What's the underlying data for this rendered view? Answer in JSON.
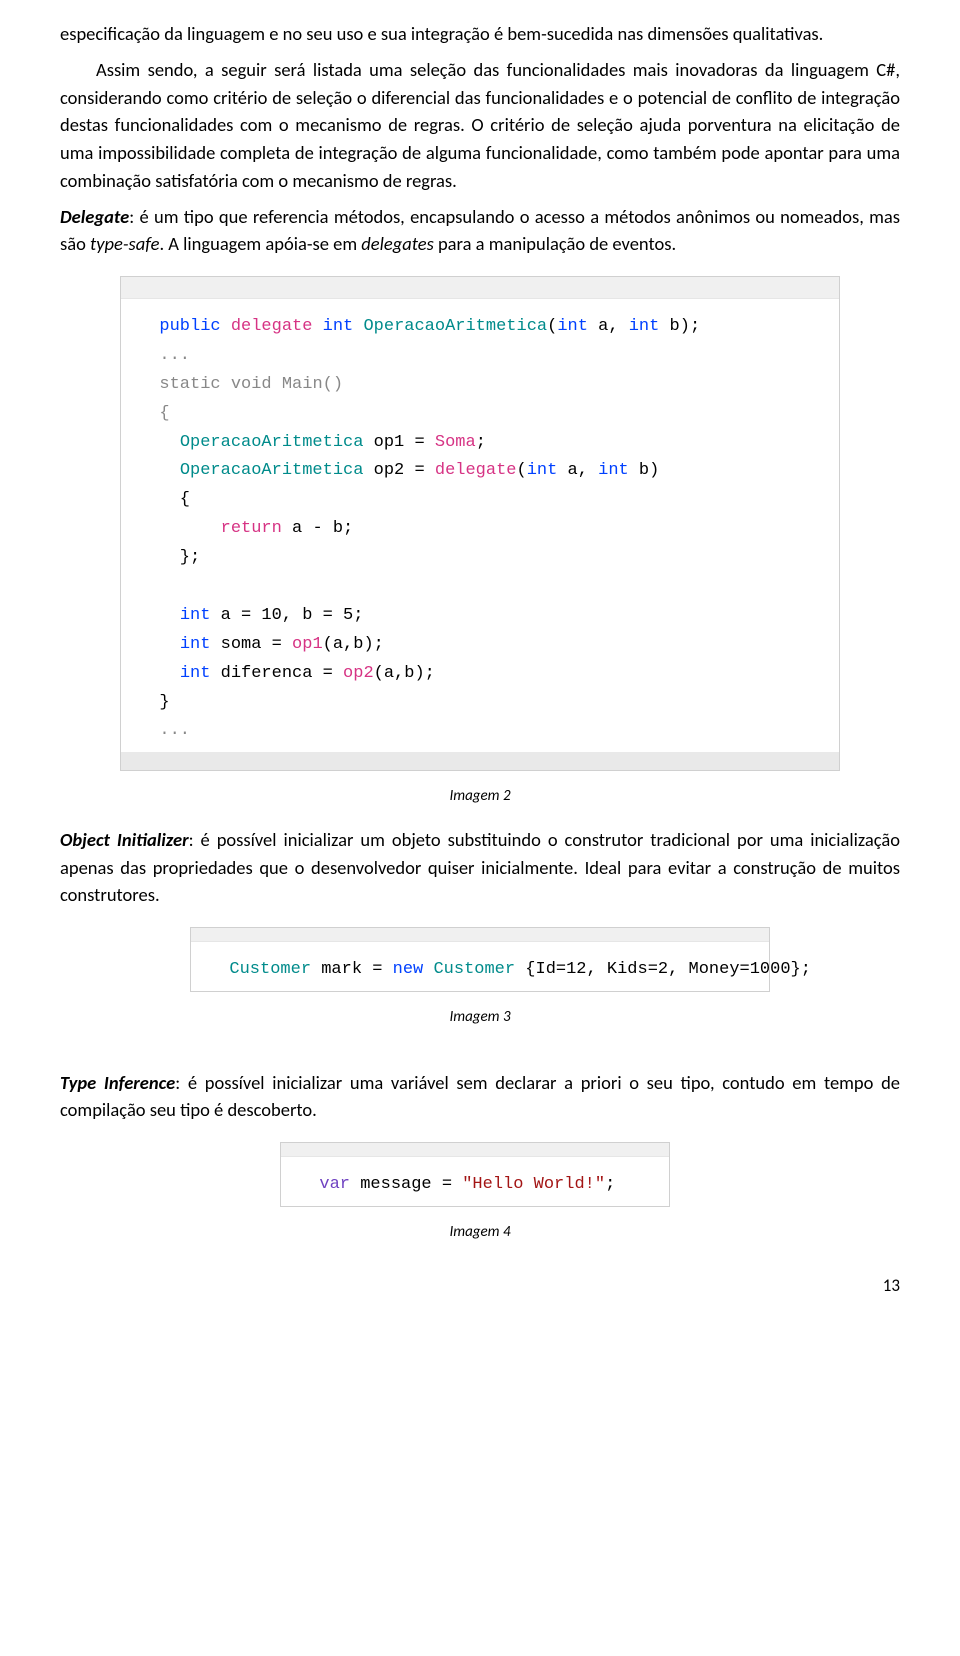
{
  "paragraphs": {
    "p1": "especificação da linguagem e no seu uso e sua integração é bem-sucedida nas dimensões qualitativas.",
    "p2": "Assim sendo, a seguir será listada uma seleção das funcionalidades mais inovadoras da linguagem C#, considerando como critério de seleção o diferencial das funcionalidades e o potencial de conflito de integração destas funcionalidades com o mecanismo de regras. O critério de seleção ajuda porventura na elicitação de uma impossibilidade completa de integração de alguma funcionalidade, como também pode apontar para uma combinação satisfatória com o mecanismo de regras.",
    "p3_prefix": "Delegate",
    "p3_body": ": é um tipo que referencia métodos, encapsulando o acesso a métodos anônimos ou nomeados, mas são ",
    "p3_italic": "type-safe",
    "p3_body2": ". A linguagem apóia-se em ",
    "p3_italic2": "delegates",
    "p3_body3": " para a manipulação de eventos.",
    "p4_prefix": "Object Initializer",
    "p4_body": ": é possível inicializar um objeto substituindo o construtor tradicional por uma inicialização apenas das propriedades que o desenvolvedor quiser inicialmente. Ideal para evitar a construção de muitos construtores.",
    "p5_prefix": "Type Inference",
    "p5_body": ": é possível inicializar uma variável sem declarar a priori o seu tipo, contudo em tempo de compilação seu tipo é descoberto."
  },
  "captions": {
    "c1": "Imagem 2",
    "c2": "Imagem 3",
    "c3": "Imagem 4"
  },
  "code1": {
    "l1_kw1": "public",
    "l1_kw2": "delegate",
    "l1_kw3": "int",
    "l1_fn": "OperacaoAritmetica",
    "l1_rest": "(",
    "l1_kw4": "int",
    "l1_a": " a, ",
    "l1_kw5": "int",
    "l1_b": " b);",
    "l2": "...",
    "l3_kw1": "static",
    "l3_kw2": "void",
    "l3_fn": "Main",
    "l3_rest": "()",
    "l4": "{",
    "l5_type": "OperacaoAritmetica",
    "l5_var": " op1 = ",
    "l5_val": "Soma",
    "l5_end": ";",
    "l6_type": "OperacaoAritmetica",
    "l6_var": " op2 = ",
    "l6_kw": "delegate",
    "l6_rest": "(",
    "l6_kw2": "int",
    "l6_a": " a, ",
    "l6_kw3": "int",
    "l6_b": " b)",
    "l7": "    {",
    "l8_kw": "return",
    "l8_rest": " a - b;",
    "l9": "    };",
    "l10": "",
    "l11_kw": "int",
    "l11_rest": " a = 10, b = 5;",
    "l12_kw": "int",
    "l12_var": " soma = ",
    "l12_call": "op1",
    "l12_rest": "(a,b);",
    "l13_kw": "int",
    "l13_var": " diferenca = ",
    "l13_call": "op2",
    "l13_rest": "(a,b);",
    "l14": "  }",
    "l15": "..."
  },
  "code2": {
    "type": "Customer",
    "var": " mark = ",
    "kw_new": "new",
    "sp": " ",
    "type2": "Customer",
    "rest": " {Id=12, Kids=2, Money=1000};"
  },
  "code3": {
    "kw": "var",
    "var": " message = ",
    "str": "\"Hello World!\"",
    "end": ";"
  },
  "page_number": "13"
}
